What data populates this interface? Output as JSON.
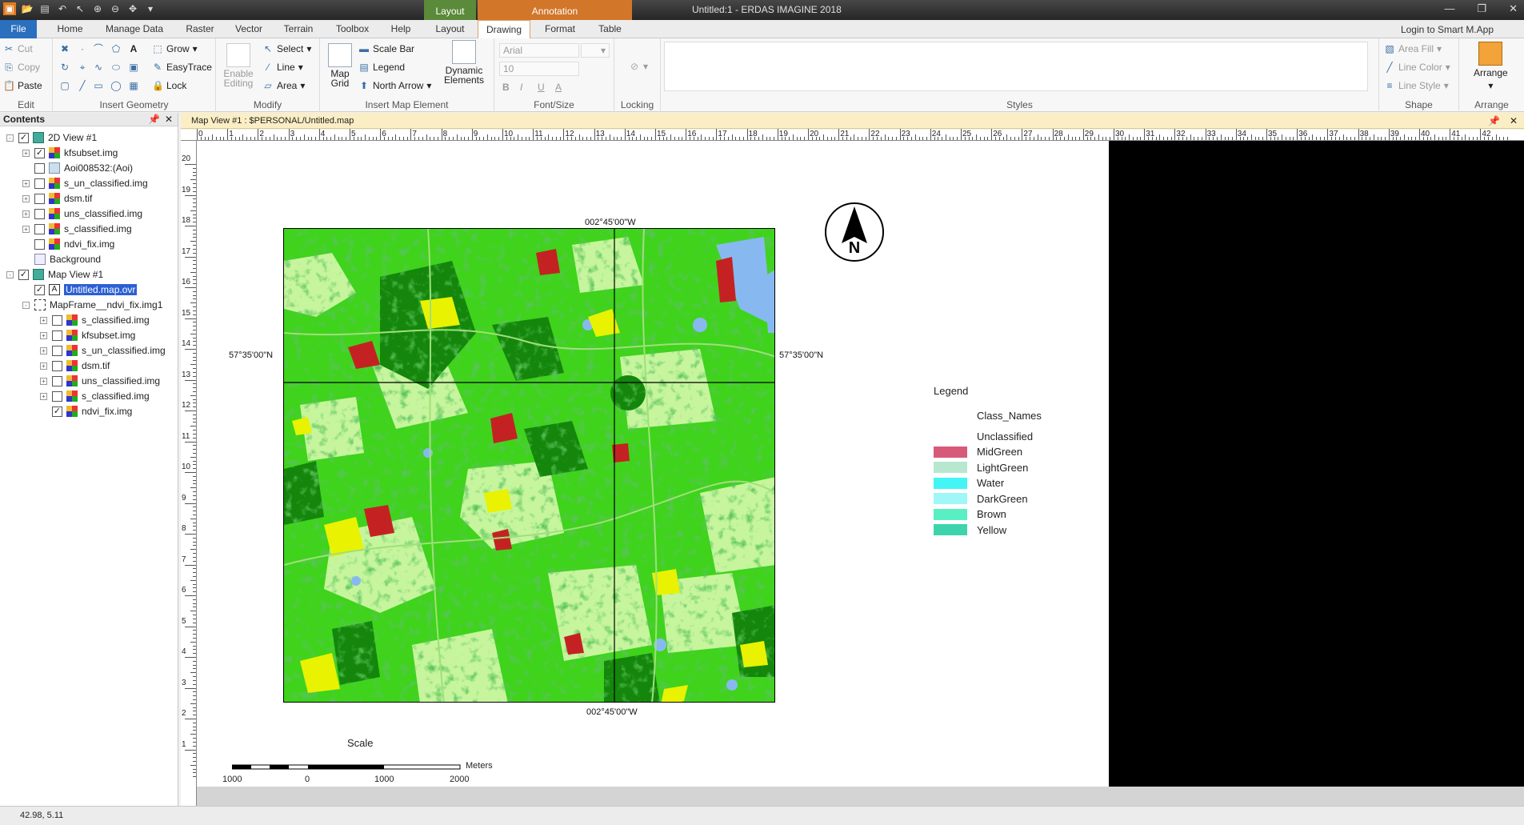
{
  "app": {
    "window_title": "Untitled:1 - ERDAS IMAGINE 2018",
    "contextual_groups": [
      "Layout",
      "Annotation"
    ],
    "login": "Login to Smart M.App"
  },
  "tabs": [
    "File",
    "Home",
    "Manage Data",
    "Raster",
    "Vector",
    "Terrain",
    "Toolbox",
    "Help",
    "Layout",
    "Drawing",
    "Format",
    "Table"
  ],
  "active_tab": "Drawing",
  "ribbon": {
    "edit": {
      "label": "Edit",
      "cut": "Cut",
      "copy": "Copy",
      "paste": "Paste"
    },
    "insert_geometry": {
      "label": "Insert Geometry",
      "grow": "Grow",
      "easytrace": "EasyTrace",
      "lock": "Lock"
    },
    "modify": {
      "label": "Modify",
      "enable_editing": "Enable Editing",
      "select": "Select",
      "line": "Line",
      "area": "Area"
    },
    "insert_map_element": {
      "label": "Insert Map Element",
      "map_grid": "Map Grid",
      "scale_bar": "Scale Bar",
      "legend": "Legend",
      "north_arrow": "North Arrow",
      "dynamic_elements": "Dynamic Elements"
    },
    "font_size": {
      "label": "Font/Size",
      "font": "Arial",
      "size": "10",
      "bold": "B",
      "italic": "I",
      "underline": "U",
      "color": "A"
    },
    "locking": {
      "label": "Locking"
    },
    "styles": {
      "label": "Styles"
    },
    "shape": {
      "label": "Shape",
      "area_fill": "Area Fill",
      "line_color": "Line Color",
      "line_style": "Line Style"
    },
    "arrange": {
      "label": "Arrange",
      "arrange": "Arrange"
    }
  },
  "contents": {
    "title": "Contents",
    "tree": [
      {
        "label": "2D View #1",
        "type": "view",
        "checked": true,
        "expand": "-"
      },
      {
        "label": "kfsubset.img",
        "type": "img",
        "checked": true,
        "expand": "+"
      },
      {
        "label": "Aoi008532:(Aoi)",
        "type": "aoi",
        "checked": false,
        "expand": ""
      },
      {
        "label": "s_un_classified.img",
        "type": "img",
        "checked": false,
        "expand": "+"
      },
      {
        "label": "dsm.tif",
        "type": "img",
        "checked": false,
        "expand": "+"
      },
      {
        "label": "uns_classified.img",
        "type": "img",
        "checked": false,
        "expand": "+"
      },
      {
        "label": "s_classified.img",
        "type": "img",
        "checked": false,
        "expand": "+"
      },
      {
        "label": "ndvi_fix.img",
        "type": "img",
        "checked": false,
        "expand": ""
      },
      {
        "label": "Background",
        "type": "bg",
        "checked": null,
        "expand": ""
      },
      {
        "label": "Map View #1",
        "type": "mapview",
        "checked": true,
        "expand": "-"
      },
      {
        "label": "Untitled.map.ovr",
        "type": "ovr",
        "checked": true,
        "expand": ""
      },
      {
        "label": "MapFrame__ndvi_fix.img1",
        "type": "frame",
        "checked": null,
        "expand": "-"
      },
      {
        "label": "s_classified.img",
        "type": "img",
        "checked": false,
        "expand": "+"
      },
      {
        "label": "kfsubset.img",
        "type": "img",
        "checked": false,
        "expand": "+"
      },
      {
        "label": "s_un_classified.img",
        "type": "img",
        "checked": false,
        "expand": "+"
      },
      {
        "label": "dsm.tif",
        "type": "img",
        "checked": false,
        "expand": "+"
      },
      {
        "label": "uns_classified.img",
        "type": "img",
        "checked": false,
        "expand": "+"
      },
      {
        "label": "s_classified.img",
        "type": "img",
        "checked": false,
        "expand": "+"
      },
      {
        "label": "ndvi_fix.img",
        "type": "img",
        "checked": true,
        "expand": ""
      }
    ]
  },
  "map_view": {
    "header": "Map View #1 : $PERSONAL/Untitled.map",
    "ruler_top": [
      "0",
      "1",
      "2",
      "3",
      "4",
      "5",
      "6",
      "7",
      "8",
      "9",
      "10",
      "11",
      "12",
      "13",
      "14",
      "15",
      "16",
      "17",
      "18",
      "19",
      "20",
      "21",
      "22",
      "23",
      "24",
      "25",
      "26",
      "27",
      "28",
      "29",
      "30",
      "31",
      "32",
      "33",
      "34",
      "35",
      "36",
      "37",
      "38",
      "39",
      "40",
      "41",
      "42"
    ],
    "ruler_left": [
      "20",
      "19",
      "18",
      "17",
      "16",
      "15",
      "14",
      "13",
      "12",
      "11",
      "10",
      "9",
      "8",
      "7",
      "6",
      "5",
      "4",
      "3",
      "2",
      "1"
    ],
    "graticule": {
      "top": "002°45'00\"W",
      "bottom": "002°45'00\"W",
      "left": "57°35'00\"N",
      "right": "57°35'00\"N"
    },
    "legend": {
      "title": "Legend",
      "header": "Class_Names",
      "classes": [
        {
          "name": "Unclassified",
          "color": "#ffffff"
        },
        {
          "name": "MidGreen",
          "color": "#d85a7a"
        },
        {
          "name": "LightGreen",
          "color": "#b7e8cf"
        },
        {
          "name": "Water",
          "color": "#43f5f5"
        },
        {
          "name": "DarkGreen",
          "color": "#a0f7f7"
        },
        {
          "name": "Brown",
          "color": "#58f0c2"
        },
        {
          "name": "Yellow",
          "color": "#3dd4ad"
        }
      ]
    },
    "scale": {
      "title": "Scale",
      "labels": [
        "1000",
        "0",
        "1000",
        "2000"
      ],
      "unit": "Meters"
    },
    "north_label": "N"
  },
  "status": {
    "coords": "42.98, 5.11"
  }
}
